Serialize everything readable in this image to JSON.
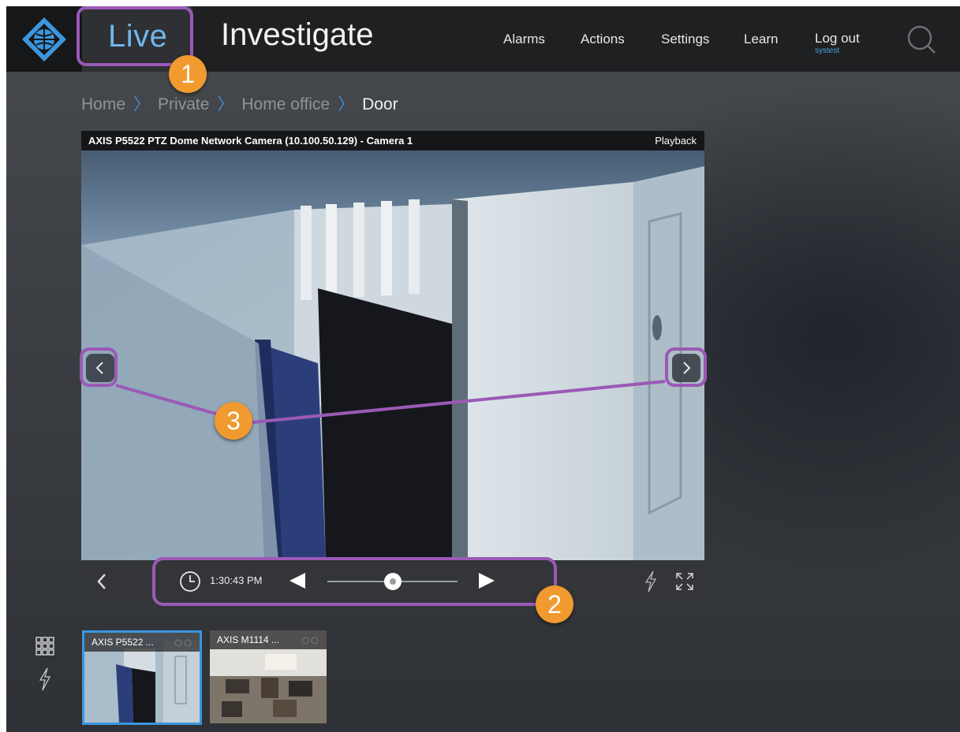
{
  "topbar": {
    "live_label": "Live",
    "investigate_label": "Investigate",
    "menu": [
      "Alarms",
      "Actions",
      "Settings",
      "Learn"
    ],
    "logout_label": "Log out",
    "username": "systest"
  },
  "breadcrumb": {
    "items": [
      "Home",
      "Private",
      "Home office"
    ],
    "current": "Door",
    "separator": "〉"
  },
  "tile": {
    "camera_title": "AXIS P5522 PTZ Dome Network Camera (10.100.50.129) - Camera 1",
    "mode": "Playback",
    "time": "1:30:43 PM",
    "playback_position": 0.5
  },
  "thumbnails": [
    {
      "label": "AXIS P5522 ...",
      "selected": true
    },
    {
      "label": "AXIS M1114 ...",
      "selected": false
    }
  ],
  "callouts": [
    "1",
    "2",
    "3"
  ],
  "icons": [
    "axis-logo-icon",
    "search-icon",
    "chevron-left-icon",
    "chevron-right-icon",
    "clock-icon",
    "play-reverse-icon",
    "play-icon",
    "lightning-icon",
    "fullscreen-icon",
    "grid-view-icon"
  ],
  "colors": {
    "accent": "#4aa3e0",
    "live": "#6fb6ea",
    "highlight": "#9b59b6",
    "callout": "#f09a2f",
    "selected_border": "#3c96dd"
  }
}
